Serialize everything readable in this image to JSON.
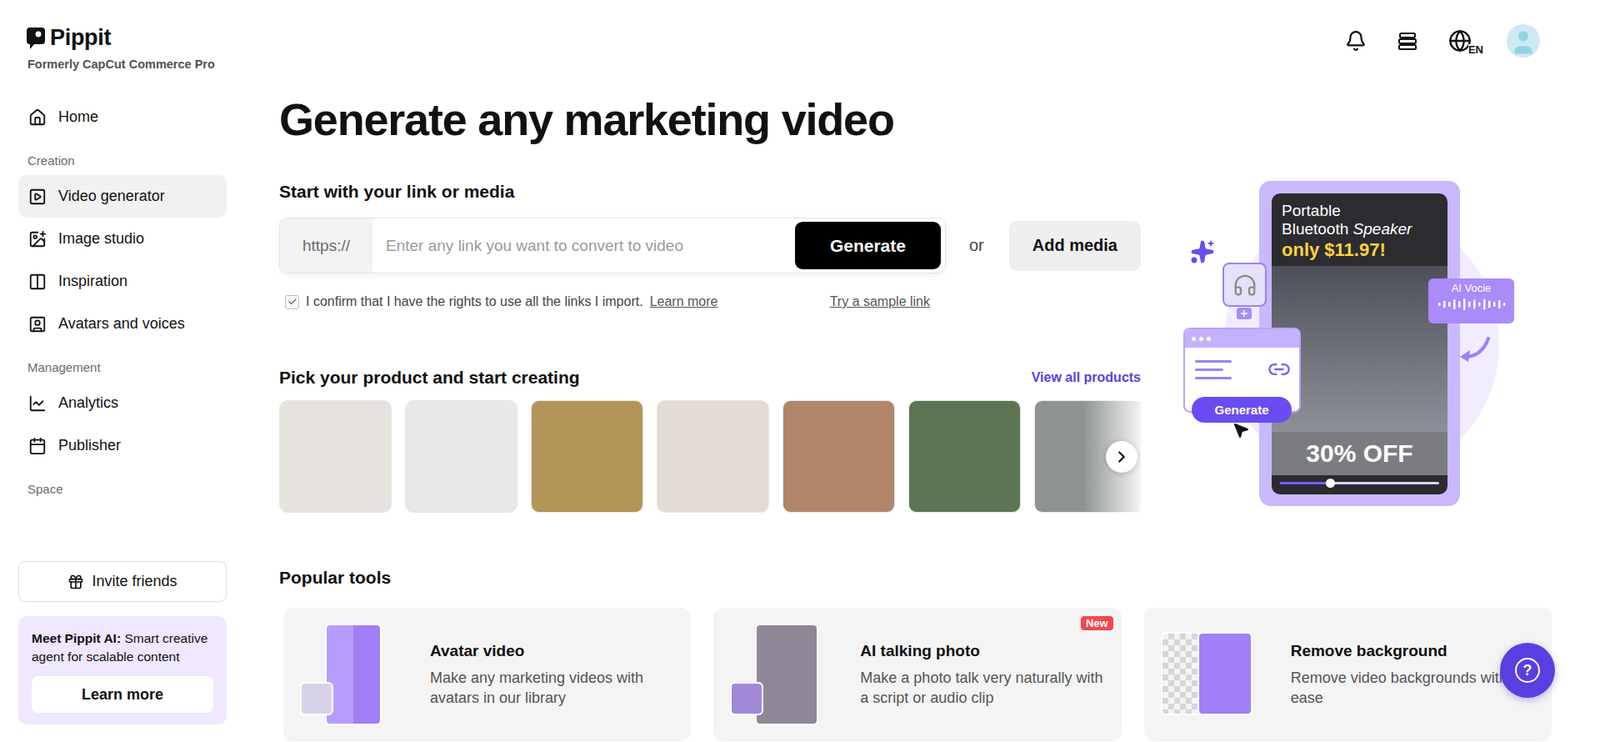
{
  "brand": {
    "name": "Pippit",
    "subtitle": "Formerly CapCut Commerce Pro"
  },
  "sidebar": {
    "home": {
      "label": "Home",
      "selected": false
    },
    "groups": [
      {
        "title": "Creation",
        "items": [
          {
            "label": "Video generator",
            "selected": true
          },
          {
            "label": "Image studio",
            "selected": false
          },
          {
            "label": "Inspiration",
            "selected": false
          },
          {
            "label": "Avatars and voices",
            "selected": false
          }
        ]
      },
      {
        "title": "Management",
        "items": [
          {
            "label": "Analytics",
            "selected": false
          },
          {
            "label": "Publisher",
            "selected": false
          }
        ]
      },
      {
        "title": "Space",
        "items": []
      }
    ],
    "invite": "Invite friends",
    "promo": {
      "title": "Meet Pippit AI:",
      "text": "Smart creative agent for scalable content",
      "button": "Learn more"
    }
  },
  "header": {
    "language": "EN"
  },
  "title": "Generate any marketing video",
  "link_section": {
    "heading": "Start with your link or media",
    "prefix": "https://",
    "placeholder": "Enter any link you want to convert to video",
    "generate": "Generate",
    "or": "or",
    "add_media": "Add media",
    "confirm": {
      "checked": true,
      "text": "I confirm that I have the rights to use all the links I import.",
      "learn_more": "Learn more"
    },
    "sample": "Try a sample link"
  },
  "products": {
    "heading": "Pick your product and start creating",
    "view_all": "View all products",
    "items": [
      {
        "color": "#e6e3df"
      },
      {
        "color": "#e8e8ea"
      },
      {
        "color": "#b39459"
      },
      {
        "color": "#e2dcd4"
      },
      {
        "color": "#b0856a"
      },
      {
        "color": "#5d7552"
      },
      {
        "color": "#8d938f"
      }
    ]
  },
  "hero": {
    "line1": "Portable",
    "line2": "Bluetooth",
    "line2_italic": "Speaker",
    "price": "only $11.97!",
    "badge": "30% OFF",
    "voice": "AI Vocie",
    "button": "Generate",
    "level": 0.32
  },
  "tools": {
    "heading": "Popular tools",
    "new_badge": "New",
    "items": [
      {
        "title": "Avatar video",
        "text": "Make any marketing videos with avatars in our library",
        "new": false
      },
      {
        "title": "AI talking photo",
        "text": "Make a photo talk very naturally with a script or audio clip",
        "new": true
      },
      {
        "title": "Remove background",
        "text": "Remove video backgrounds with ease",
        "new": false
      }
    ]
  },
  "help": "?"
}
